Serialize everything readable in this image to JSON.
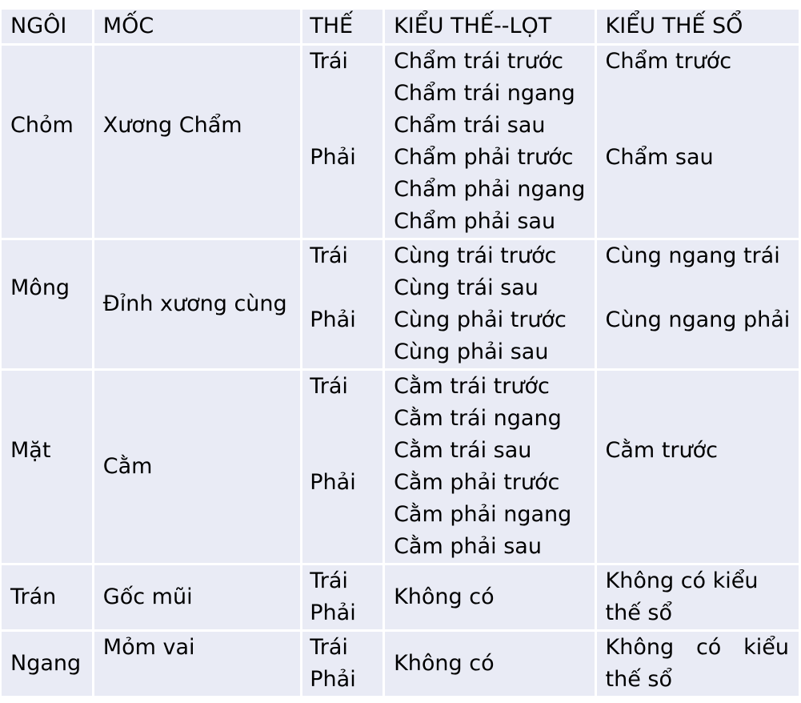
{
  "header": {
    "col1": "NGÔI",
    "col2": "MỐC",
    "col3": "THẾ",
    "col4": "KIỂU THẾ--LỌT",
    "col5": "KIỂU THẾ SỔ"
  },
  "rows": [
    {
      "ngoi": "Chỏm",
      "moc": "Xương Chẩm",
      "the": [
        "Trái",
        "Phải"
      ],
      "lot": [
        "Chẩm trái trước",
        "Chẩm trái ngang",
        "Chẩm trái sau",
        "Chẩm phải trước",
        "Chẩm phải ngang",
        "Chẩm phải sau"
      ],
      "so": [
        "Chẩm trước",
        "Chẩm sau"
      ]
    },
    {
      "ngoi": "Mông",
      "moc": "Đỉnh xương cùng",
      "the": [
        "Trái",
        "Phải"
      ],
      "lot": [
        "Cùng trái trước",
        "Cùng trái sau",
        "Cùng phải trước",
        "Cùng phải sau"
      ],
      "so": [
        "Cùng ngang trái",
        "Cùng ngang phải"
      ]
    },
    {
      "ngoi": "Mặt",
      "moc": "Cằm",
      "the": [
        "Trái",
        "Phải"
      ],
      "lot": [
        "Cằm trái trước",
        "Cằm trái ngang",
        "Cằm trái sau",
        "Cằm phải trước",
        "Cằm phải ngang",
        "Cằm phải sau"
      ],
      "so": [
        "Cằm trước"
      ]
    },
    {
      "ngoi": "Trán",
      "moc": "Gốc mũi",
      "the": [
        "Trái",
        "Phải"
      ],
      "lot": [
        "Không có"
      ],
      "so": [
        "Không có kiểu",
        "thế sổ"
      ]
    },
    {
      "ngoi": "Ngang",
      "moc": "Mỏm vai",
      "the": [
        "Trái",
        "Phải"
      ],
      "lot": [
        "Không có"
      ],
      "so_words": [
        "Không",
        "có",
        "kiểu"
      ],
      "so_last": "thế sổ"
    }
  ]
}
